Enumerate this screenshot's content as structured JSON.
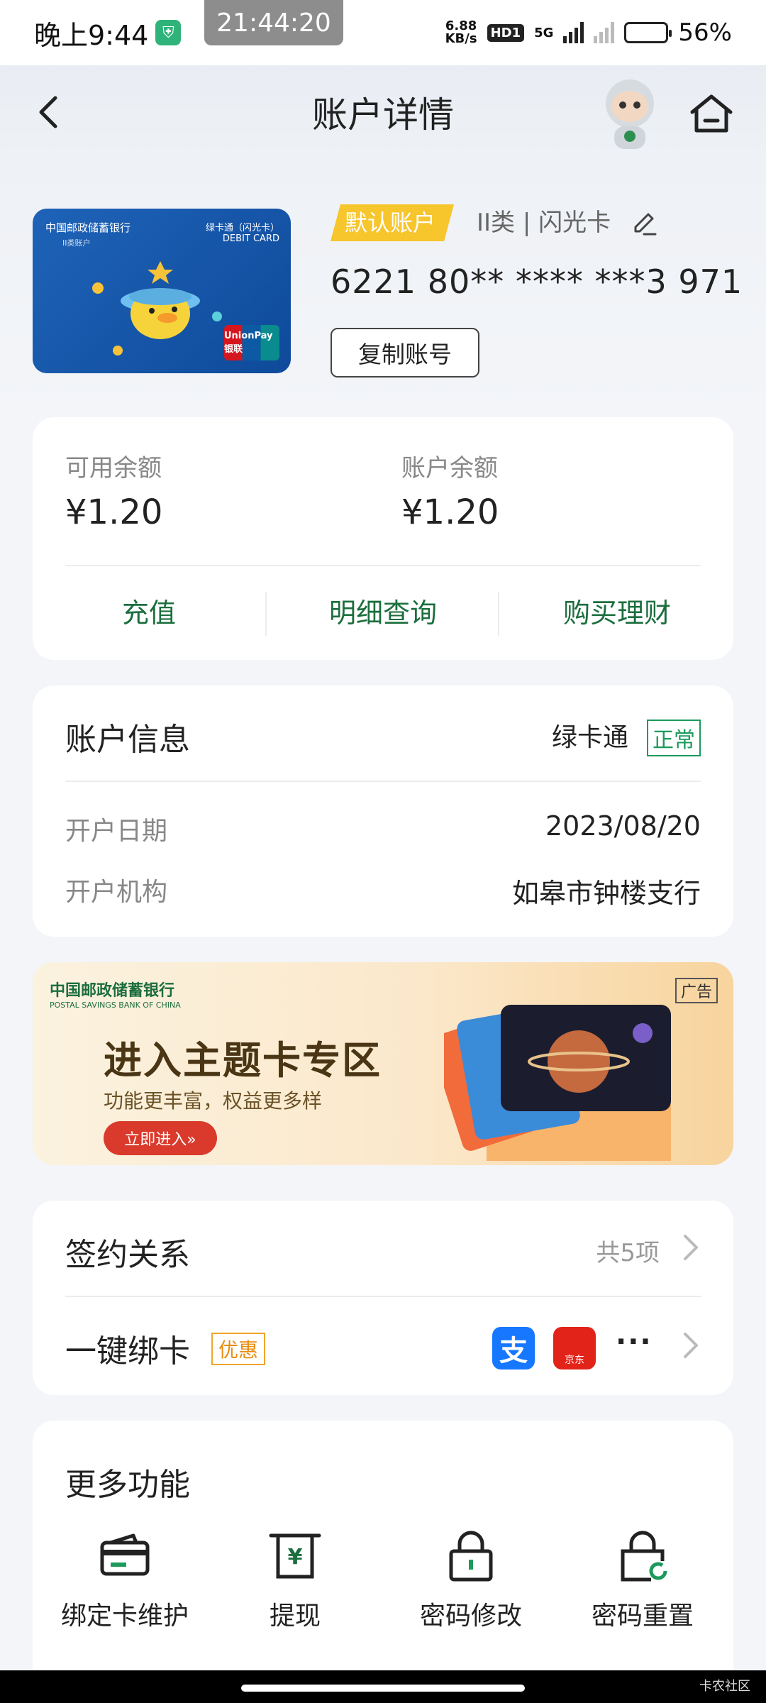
{
  "status_bar": {
    "time": "晚上9:44",
    "clock_overlay": "21:44:20",
    "net_speed_value": "6.88",
    "net_speed_unit": "KB/s",
    "hd": "HD1",
    "network": "5G",
    "battery": "56%"
  },
  "header": {
    "title": "账户详情"
  },
  "account": {
    "default_tag": "默认账户",
    "class_label": "II类 | 闪光卡",
    "number": "6221 80** **** ***3 971",
    "copy_button": "复制账号",
    "card": {
      "bank_name": "中国邮政储蓄银行",
      "card_type": "绿卡通（闪光卡）",
      "card_type_en": "DEBIT CARD",
      "card_sub": "II类账户",
      "network": "UnionPay 银联"
    }
  },
  "balance": {
    "available_label": "可用余额",
    "available_value": "¥1.20",
    "account_label": "账户余额",
    "account_value": "¥1.20",
    "actions": [
      "充值",
      "明细查询",
      "购买理财"
    ]
  },
  "account_info": {
    "title": "账户信息",
    "type": "绿卡通",
    "status": "正常",
    "rows": [
      {
        "label": "开户日期",
        "value": "2023/08/20"
      },
      {
        "label": "开户机构",
        "value": "如皋市钟楼支行"
      }
    ]
  },
  "banner": {
    "logo": "中国邮政储蓄银行",
    "logo_en": "POSTAL SAVINGS BANK OF CHINA",
    "title": "进入主题卡专区",
    "subtitle": "功能更丰富，权益更多样",
    "button": "立即进入»",
    "ad_tag": "广告"
  },
  "contracts": {
    "sign_title": "签约关系",
    "sign_count": "共5项",
    "bind_title": "一键绑卡",
    "promo_tag": "优惠",
    "alipay_glyph": "支",
    "jd_label": "京东",
    "more": "···"
  },
  "more_functions": {
    "title": "更多功能",
    "items": [
      {
        "label": "绑定卡维护",
        "icon": "card-icon"
      },
      {
        "label": "提现",
        "icon": "withdraw-icon"
      },
      {
        "label": "密码修改",
        "icon": "lock-icon"
      },
      {
        "label": "密码重置",
        "icon": "lock-reset-icon"
      }
    ]
  },
  "watermark": "卡农社区",
  "colors": {
    "accent_green": "#1c6e3e",
    "tag_yellow": "#f7c52c",
    "status_green": "#1c9a5c",
    "promo_orange": "#f0a52a",
    "banner_button_red": "#d93a2b"
  }
}
